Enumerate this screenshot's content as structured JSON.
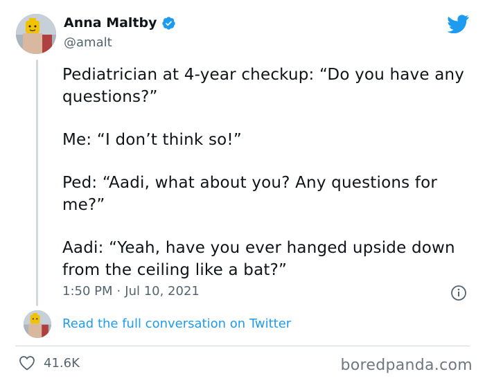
{
  "author": {
    "name": "Anna Maltby",
    "handle": "@amalt"
  },
  "tweet": {
    "lines": [
      "Pediatrician at 4-year checkup: “Do you have any questions?”",
      "Me: “I don’t think so!”",
      "Ped: “Aadi, what about you? Any questions for me?”",
      "Aadi: “Yeah, have you ever hanged upside down from the ceiling like a bat?”"
    ],
    "time": "1:50 PM",
    "separator": "·",
    "date": "Jul 10, 2021"
  },
  "footer": {
    "read_link": "Read the full conversation on Twitter",
    "likes": "41.6K",
    "watermark": "boredpanda.com"
  },
  "icons": {
    "verified": "verified-badge-icon",
    "twitter": "twitter-bird-icon",
    "info": "info-icon",
    "like": "heart-icon"
  },
  "colors": {
    "twitter_blue": "#1d9bf0",
    "text": "#0f1419",
    "muted": "#536471"
  }
}
